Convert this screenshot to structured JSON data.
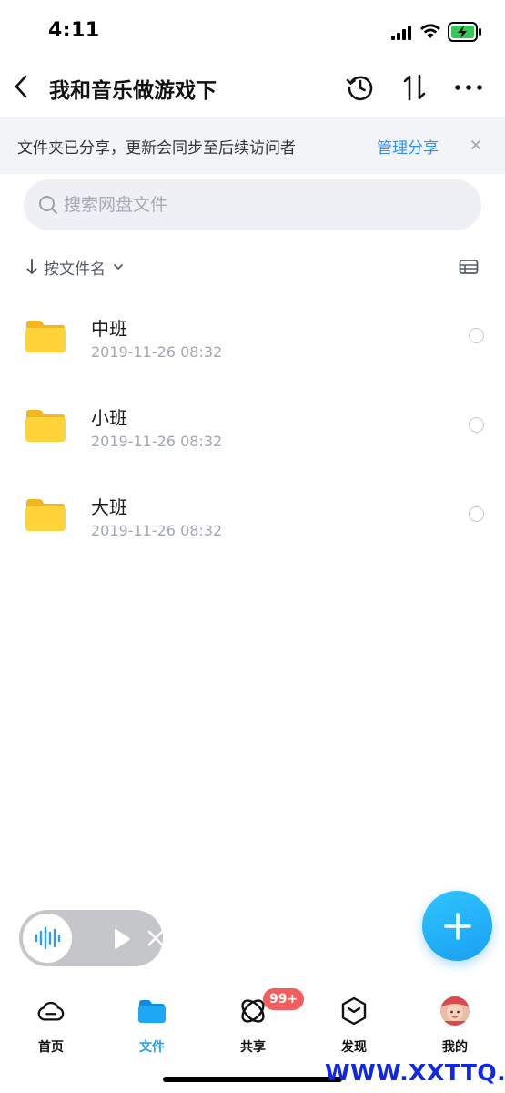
{
  "status_bar": {
    "time": "4:11"
  },
  "header": {
    "title": "我和音乐做游戏下"
  },
  "share_banner": {
    "text": "文件夹已分享，更新会同步至后续访问者",
    "action": "管理分享"
  },
  "search": {
    "placeholder": "搜索网盘文件"
  },
  "sort": {
    "label": "按文件名"
  },
  "files": [
    {
      "name": "中班",
      "date": "2019-11-26 08:32"
    },
    {
      "name": "小班",
      "date": "2019-11-26 08:32"
    },
    {
      "name": "大班",
      "date": "2019-11-26 08:32"
    }
  ],
  "tabs": [
    {
      "label": "首页",
      "icon": "cloud-icon",
      "active": false
    },
    {
      "label": "文件",
      "icon": "folder-icon",
      "active": true
    },
    {
      "label": "共享",
      "icon": "share-icon",
      "active": false
    },
    {
      "label": "发现",
      "icon": "discover-icon",
      "active": false
    },
    {
      "label": "我的",
      "icon": "avatar",
      "active": false
    }
  ],
  "share_badge": "99+",
  "watermark": "WWW.XXTTQ.COM",
  "colors": {
    "accent": "#1aa0f2",
    "link": "#2f8ff5",
    "badge": "#f35d5d",
    "folder": "#ffcf2e"
  }
}
